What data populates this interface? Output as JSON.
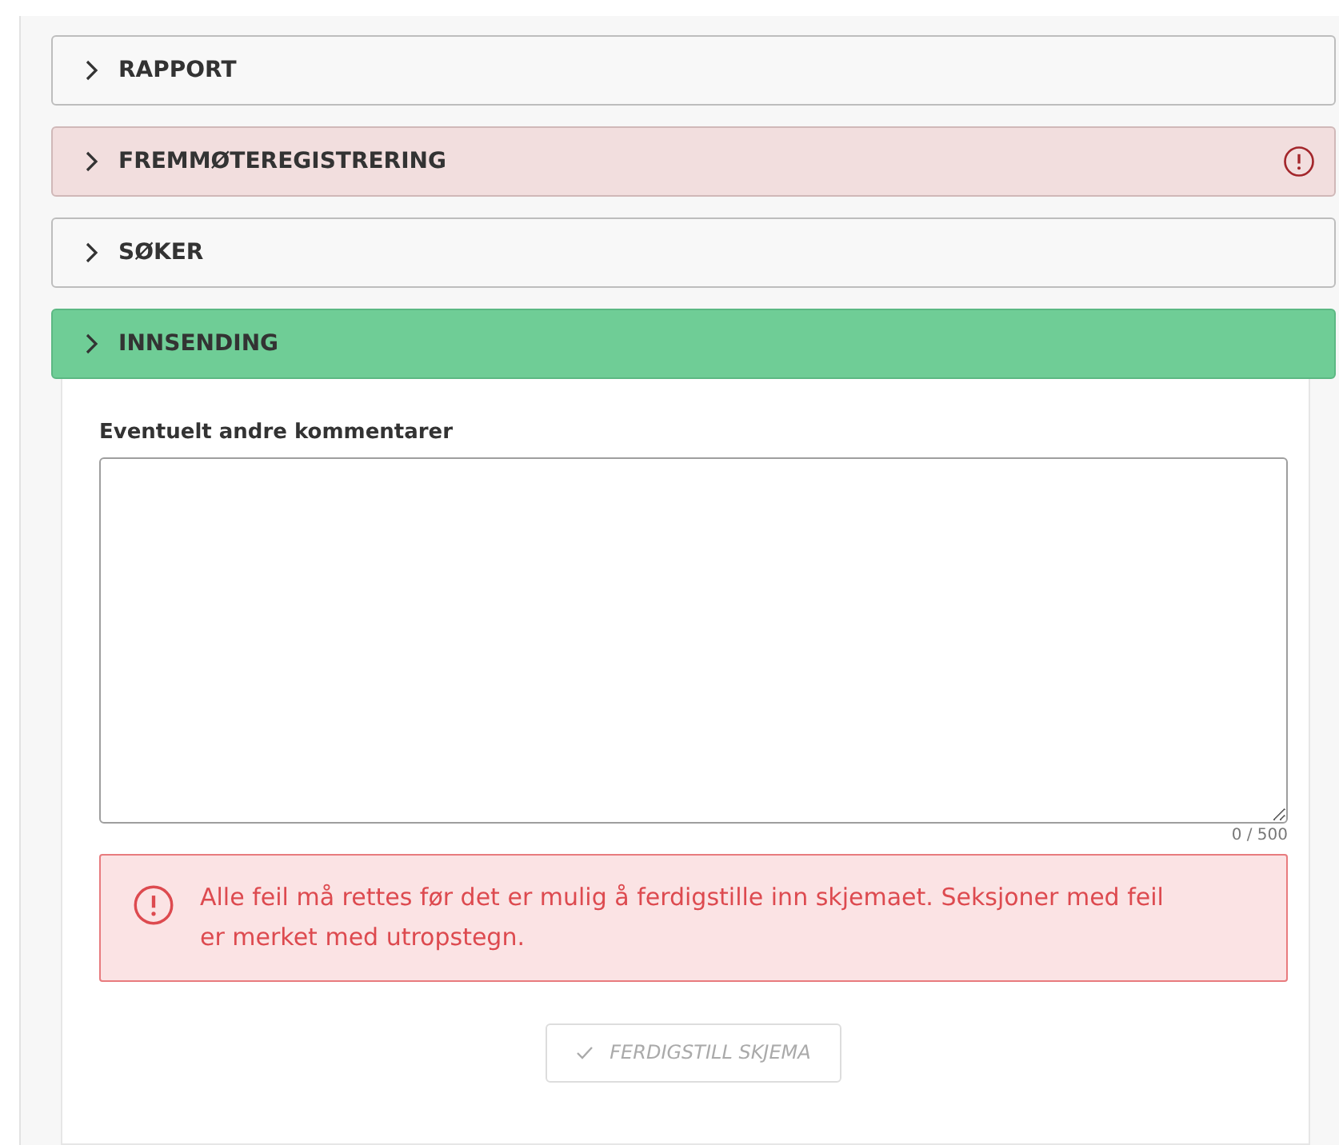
{
  "sections": [
    {
      "title": "RAPPORT",
      "kind": "neutral"
    },
    {
      "title": "FREMMØTEREGISTRERING",
      "kind": "error"
    },
    {
      "title": "SØKER",
      "kind": "neutral"
    },
    {
      "title": "INNSENDING",
      "kind": "success"
    }
  ],
  "comment_field": {
    "label": "Eventuelt andre kommentarer",
    "counter": "0 / 500"
  },
  "error_message": "Alle feil må rettes før det er mulig å ferdigstille inn skjemaet. Seksjoner med feil er merket med utropstegn.",
  "submit_button": {
    "label": "FERDIGSTILL SKJEMA",
    "disabled": true
  }
}
